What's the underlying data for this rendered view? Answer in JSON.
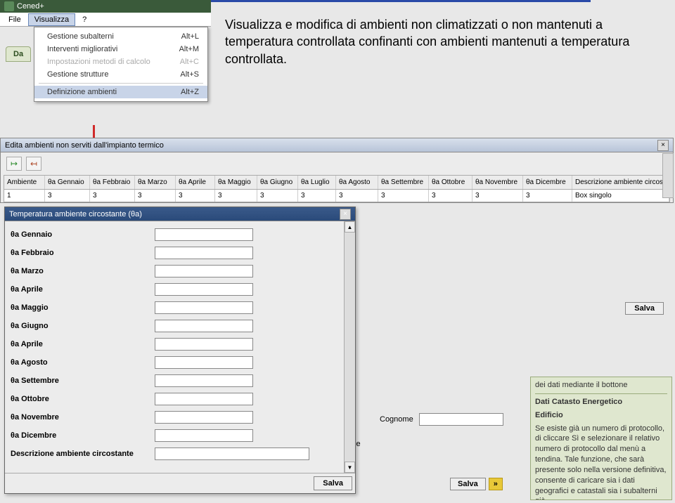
{
  "app": {
    "title": "Cened+"
  },
  "menubar": {
    "file": "File",
    "visualizza": "Visualizza",
    "help": "?"
  },
  "dropdown": {
    "items": [
      {
        "label": "Gestione subalterni",
        "key": "Alt+L",
        "enabled": true
      },
      {
        "label": "Interventi migliorativi",
        "key": "Alt+M",
        "enabled": true
      },
      {
        "label": "Impostazioni metodi di calcolo",
        "key": "Alt+C",
        "enabled": false
      },
      {
        "label": "Gestione strutture",
        "key": "Alt+S",
        "enabled": true
      },
      {
        "label": "Definizione ambienti",
        "key": "Alt+Z",
        "enabled": true,
        "highlight": true
      }
    ]
  },
  "tab_behind": "Da",
  "note": "Visualizza e modifica di ambienti non climatizzati o non mantenuti a temperatura controllata confinanti con ambienti mantenuti a temperatura controllata.",
  "editWin": {
    "title": "Edita ambienti non serviti dall'impianto termico",
    "icons": {
      "in": "↦",
      "out": "↤"
    },
    "headers": [
      "Ambiente",
      "θa Gennaio",
      "θa Febbraio",
      "θa Marzo",
      "θa Aprile",
      "θa Maggio",
      "θa Giugno",
      "θa Luglio",
      "θa Agosto",
      "θa Settembre",
      "θa Ottobre",
      "θa Novembre",
      "θa Dicembre",
      "Descrizione ambiente circostante"
    ],
    "row": [
      "1",
      "3",
      "3",
      "3",
      "3",
      "3",
      "3",
      "3",
      "3",
      "3",
      "3",
      "3",
      "3",
      "Box singolo"
    ]
  },
  "tempWin": {
    "title": "Temperatura ambiente circostante (θa)",
    "fields": [
      "θa Gennaio",
      "θa Febbraio",
      "θa Marzo",
      "θa Aprile",
      "θa Maggio",
      "θa Giugno",
      "θa Aprile",
      "θa Agosto",
      "θa Settembre",
      "θa Ottobre",
      "θa Novembre",
      "θa Dicembre",
      "Descrizione ambiente circostante"
    ],
    "salva": "Salva"
  },
  "misc": {
    "salva": "Salva",
    "cognome_label": "Cognome",
    "ale": "ale",
    "arrow": "»"
  },
  "helpPane": {
    "line0": "dei dati mediante il bottone",
    "title1": "Dati Catasto Energetico",
    "title2": "Edificio",
    "body": "Se esiste già un numero di protocollo, di cliccare Sì e selezionare il relativo numero di protocollo dal menù a tendina. Tale funzione, che sarà presente solo nella versione definitiva, consente di caricare sia i dati geografici e catastali sia i subalterni già"
  }
}
